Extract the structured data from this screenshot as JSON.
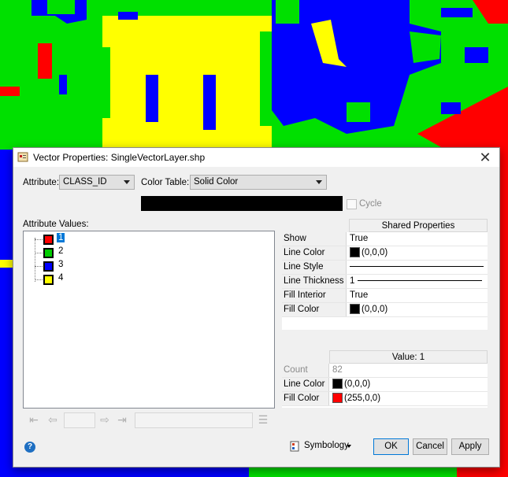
{
  "window": {
    "title": "Vector Properties: SingleVectorLayer.shp",
    "close_glyph": "✕"
  },
  "attribute": {
    "label": "Attribute:",
    "value": "CLASS_ID"
  },
  "color_table": {
    "label": "Color Table:",
    "value": "Solid Color"
  },
  "cycle": {
    "label": "Cycle",
    "checked": false
  },
  "attribute_values": {
    "label": "Attribute Values:",
    "items": [
      {
        "label": "1",
        "color": "#ff0000",
        "selected": true
      },
      {
        "label": "2",
        "color": "#00cc00",
        "selected": false
      },
      {
        "label": "3",
        "color": "#0000ff",
        "selected": false
      },
      {
        "label": "4",
        "color": "#ffff00",
        "selected": false
      }
    ]
  },
  "shared_properties": {
    "header": "Shared Properties",
    "rows": [
      {
        "name": "Show",
        "value": "True"
      },
      {
        "name": "Line Color",
        "value": "(0,0,0)",
        "swatch": "#000000"
      },
      {
        "name": "Line Style",
        "value": ""
      },
      {
        "name": "Line Thickness",
        "value": "1"
      },
      {
        "name": "Fill Interior",
        "value": "True"
      },
      {
        "name": "Fill Color",
        "value": "(0,0,0)",
        "swatch": "#000000"
      }
    ]
  },
  "value_properties": {
    "header": "Value: 1",
    "rows": [
      {
        "name": "Count",
        "value": "82"
      },
      {
        "name": "Line Color",
        "value": "(0,0,0)",
        "swatch": "#000000"
      },
      {
        "name": "Fill Color",
        "value": "(255,0,0)",
        "swatch": "#ff0000"
      }
    ]
  },
  "symbology_label": "Symbology",
  "buttons": {
    "ok": "OK",
    "cancel": "Cancel",
    "apply": "Apply"
  },
  "help_glyph": "?"
}
